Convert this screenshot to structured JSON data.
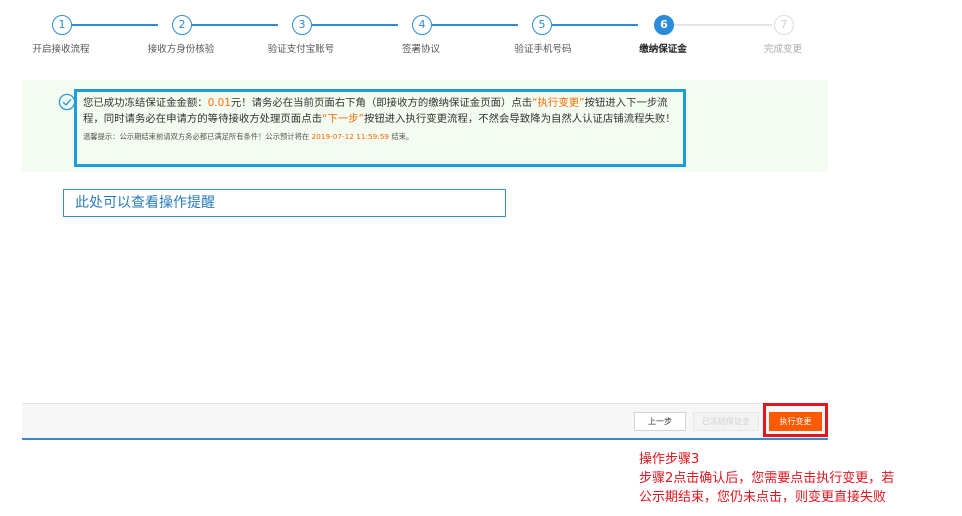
{
  "steps": [
    {
      "num": "1",
      "label": "开启接收流程",
      "state": "done"
    },
    {
      "num": "2",
      "label": "接收方身份核验",
      "state": "done"
    },
    {
      "num": "3",
      "label": "验证支付宝账号",
      "state": "done"
    },
    {
      "num": "4",
      "label": "签署协议",
      "state": "done"
    },
    {
      "num": "5",
      "label": "验证手机号码",
      "state": "done"
    },
    {
      "num": "6",
      "label": "缴纳保证金",
      "state": "active"
    },
    {
      "num": "7",
      "label": "完成变更",
      "state": "inactive"
    }
  ],
  "notice": {
    "part1": "您已成功冻结保证金金额：",
    "amount": "0.01",
    "part2": "元！请务必在当前页面右下角（即接收方的缴纳保证金页面）点击",
    "exec_link": "“执行变更”",
    "part3": "按钮进入下一步流程，同时请务必在申请方的等待接收方处理页面点击",
    "next_link": "“下一步”",
    "part4": "按钮进入执行变更流程，不然会导致降为自然人认证店铺流程失败！",
    "tip_prefix": "温馨提示：公示期结束前请双方务必都已满足所有条件！公示预计将在 ",
    "tip_date": "2019-07-12 11:59:59",
    "tip_suffix": " 结束。"
  },
  "annotation": "此处可以查看操作提醒",
  "buttons": {
    "prev": "上一步",
    "frozen": "已冻结保证金",
    "execute": "执行变更"
  },
  "side_note": {
    "line1": "操作步骤3",
    "line2": "步骤2点击确认后，您需要点击执行变更，若",
    "line3": "公示期结束，您仍未点击，则变更直接失败"
  },
  "colors": {
    "accent": "#2b8cd9",
    "orange": "#ff6a00",
    "highlight_red": "#e4151f"
  }
}
